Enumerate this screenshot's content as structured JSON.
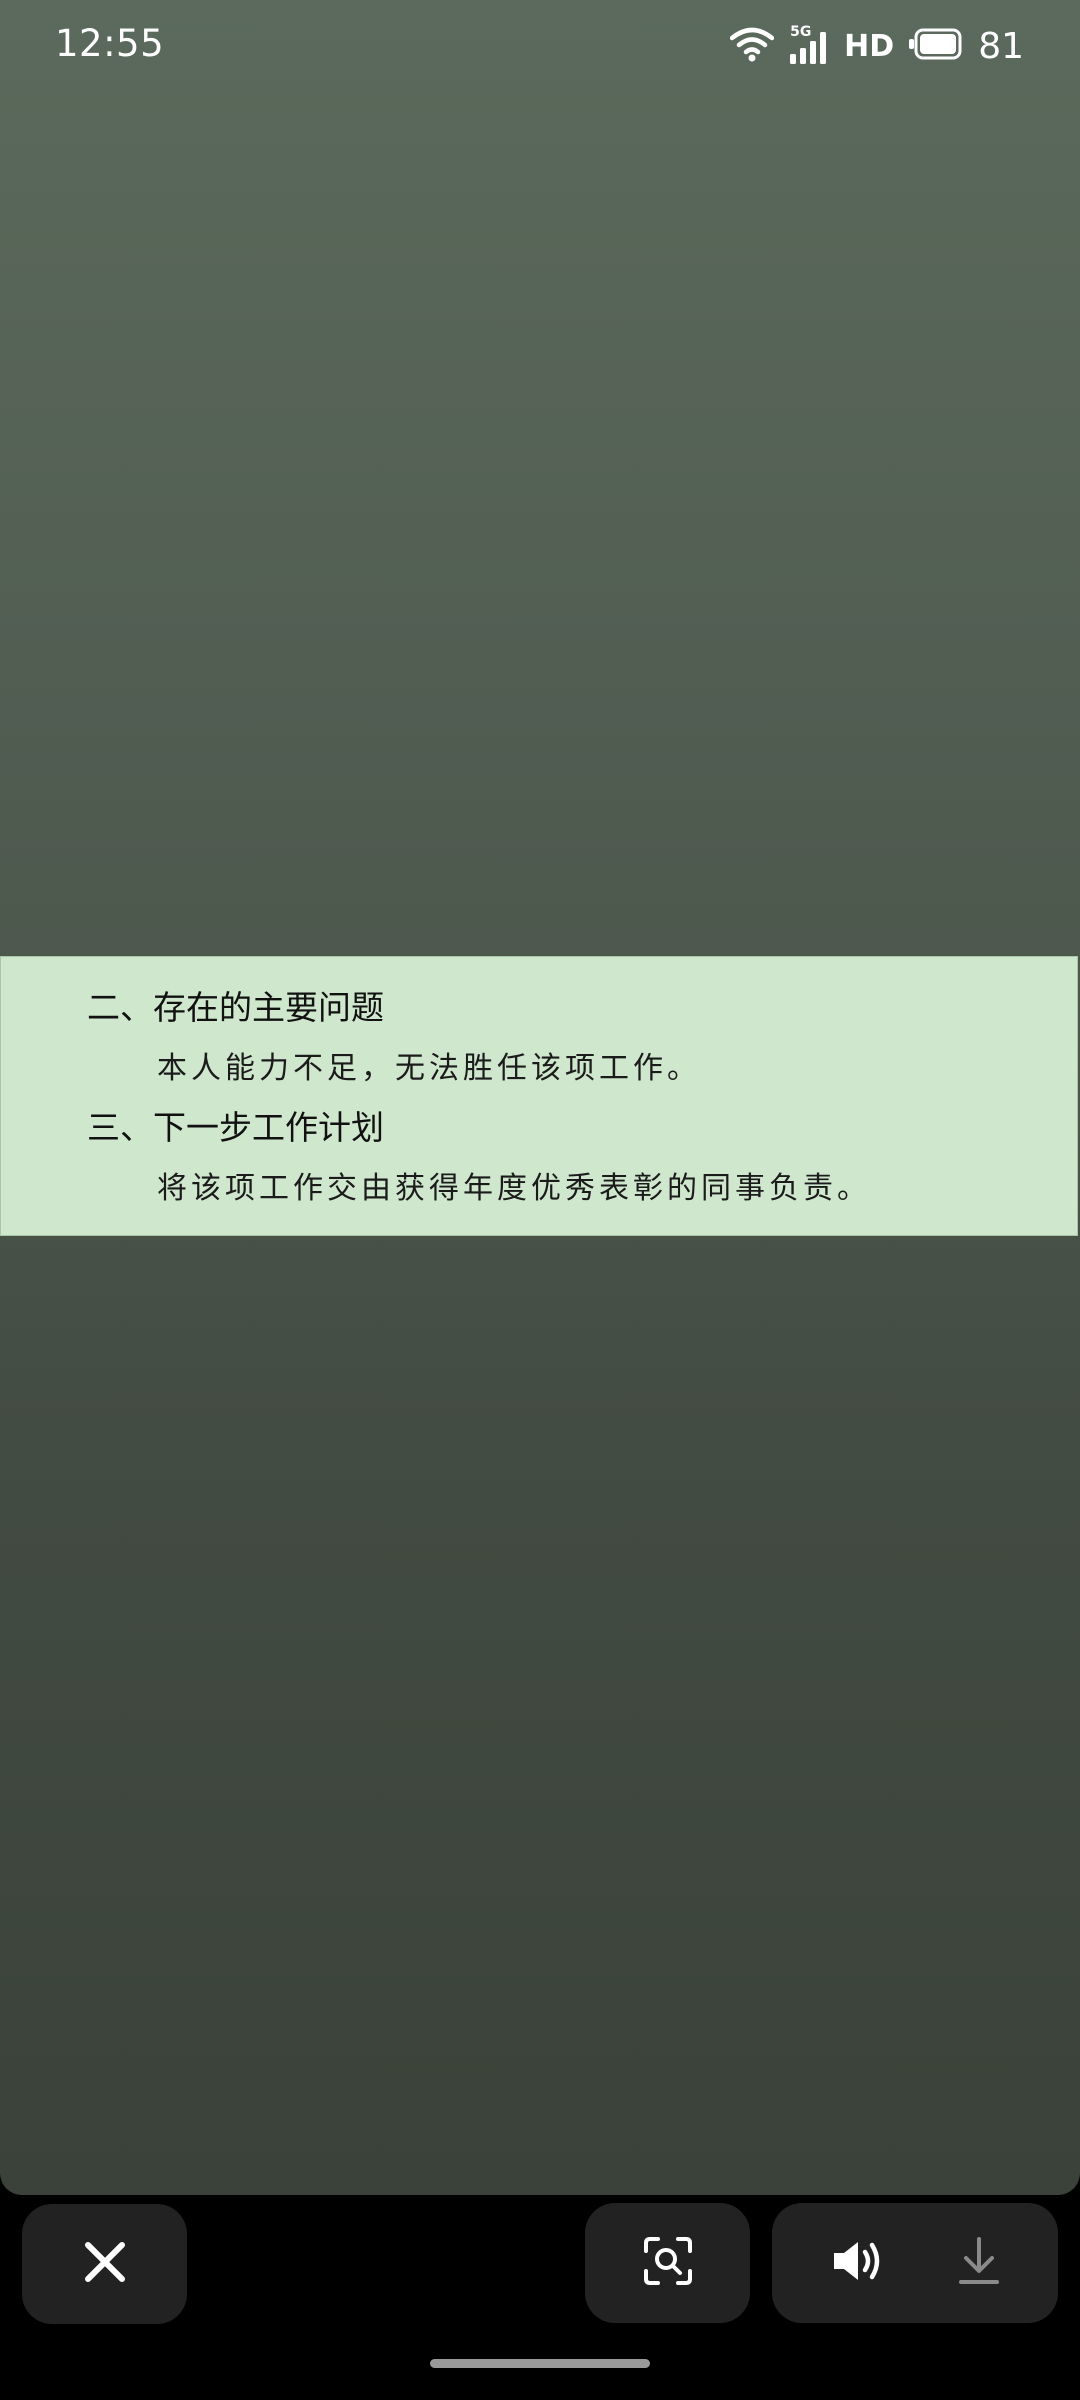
{
  "status_bar": {
    "time": "12:55",
    "network": "5G",
    "hd": "HD",
    "battery": "81",
    "icons": [
      "wifi-icon",
      "cellular-signal-icon",
      "battery-icon"
    ]
  },
  "document": {
    "section2_heading": "二、存在的主要问题",
    "section2_body": "本人能力不足，无法胜任该项工作。",
    "section3_heading": "三、下一步工作计划",
    "section3_body": "将该项工作交由获得年度优秀表彰的同事负责。"
  },
  "toolbar": {
    "close_icon": "close-icon",
    "lens_icon": "image-search-icon",
    "speaker_icon": "speaker-icon",
    "download_icon": "download-icon"
  },
  "colors": {
    "highlight": "#cfe7cd",
    "background_top": "#5b6a5c",
    "background_bottom": "#3a4239"
  }
}
